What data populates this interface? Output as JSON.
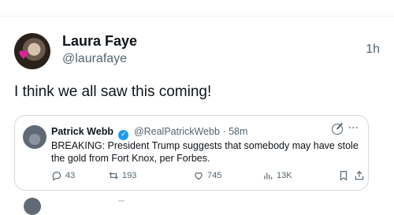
{
  "post": {
    "display_name": "Laura Faye",
    "handle": "@laurafaye",
    "time": "1h",
    "text": "I think we all saw this coming!"
  },
  "quote": {
    "display_name": "Patrick Webb",
    "handle": "@RealPatrickWebb",
    "time": "58m",
    "text": "BREAKING: President Trump suggests that somebody may have stole the gold from Fort Knox, per Forbes.",
    "replies": "43",
    "reposts": "193",
    "likes": "745",
    "views": "13K"
  },
  "colors": {
    "text": "#0f1419",
    "secondary": "#536471",
    "border": "#cfd9de",
    "verified": "#1d9bf0"
  },
  "icons": [
    "heart-sticker-icon",
    "verified-badge-icon",
    "grok-icon",
    "more-icon",
    "reply-icon",
    "retweet-icon",
    "like-icon",
    "views-icon",
    "bookmark-icon",
    "share-icon"
  ]
}
